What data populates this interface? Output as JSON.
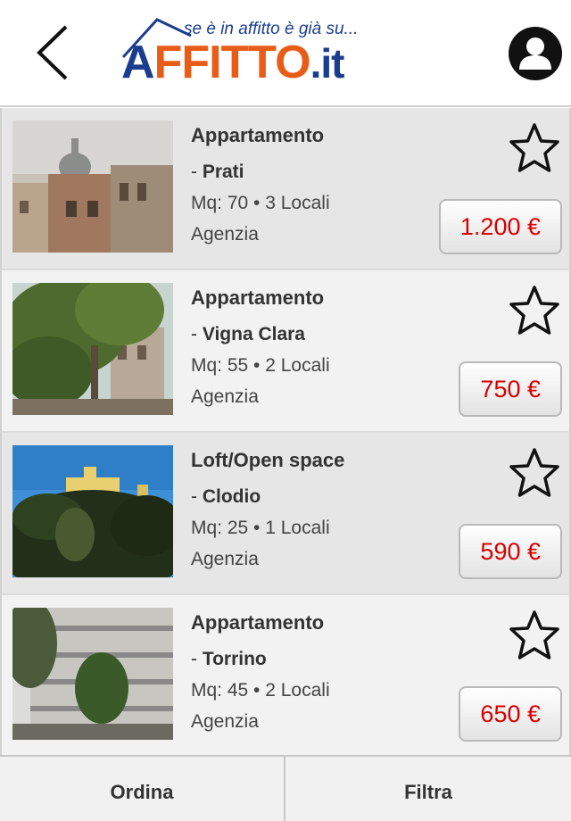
{
  "header": {
    "logo_tagline": "se è in affitto è già su...",
    "logo_brand_a": "A",
    "logo_brand_main": "FFITTO",
    "logo_brand_tld": ".it"
  },
  "listings": [
    {
      "title": "Appartamento",
      "zone_prefix": "- ",
      "zone": "Prati",
      "specs": "Mq: 70 • 3 Locali",
      "agency": "Agenzia",
      "price": "1.200 €"
    },
    {
      "title": "Appartamento",
      "zone_prefix": "- ",
      "zone": "Vigna Clara",
      "specs": "Mq: 55 • 2 Locali",
      "agency": "Agenzia",
      "price": "750 €"
    },
    {
      "title": "Loft/Open space",
      "zone_prefix": "- ",
      "zone": "Clodio",
      "specs": "Mq: 25 • 1 Locali",
      "agency": "Agenzia",
      "price": "590 €"
    },
    {
      "title": "Appartamento",
      "zone_prefix": "- ",
      "zone": "Torrino",
      "specs": "Mq: 45 • 2 Locali",
      "agency": "Agenzia",
      "price": "650 €"
    }
  ],
  "footer": {
    "sort_label": "Ordina",
    "filter_label": "Filtra"
  },
  "colors": {
    "price": "#d80000",
    "brand_blue": "#1a3d8f",
    "brand_orange": "#e85c17"
  },
  "icons": {
    "back": "chevron-left-icon",
    "user": "user-icon",
    "favorite": "star-outline-icon"
  }
}
